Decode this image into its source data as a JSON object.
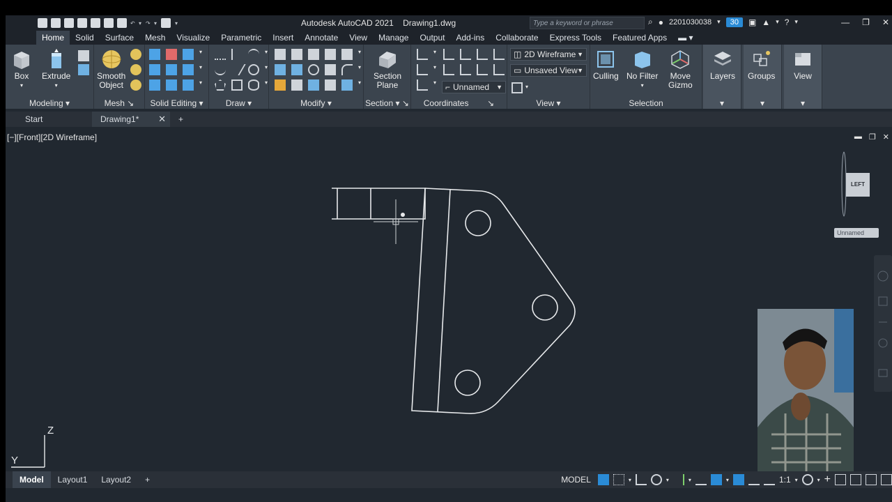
{
  "titlebar": {
    "app_name": "Autodesk AutoCAD 2021",
    "file_name": "Drawing1.dwg",
    "search_placeholder": "Type a keyword or phrase",
    "user_id": "2201030038",
    "notifications": "30"
  },
  "tabs": [
    "Home",
    "Solid",
    "Surface",
    "Mesh",
    "Visualize",
    "Parametric",
    "Insert",
    "Annotate",
    "View",
    "Manage",
    "Output",
    "Add-ins",
    "Collaborate",
    "Express Tools",
    "Featured Apps"
  ],
  "active_tab": "Home",
  "ribbon": {
    "box_label": "Box",
    "extrude_label": "Extrude",
    "smooth_label1": "Smooth",
    "smooth_label2": "Object",
    "section_label1": "Section",
    "section_label2": "Plane",
    "culling_label": "Culling",
    "nofilter_label": "No Filter",
    "gizmo_label1": "Move",
    "gizmo_label2": "Gizmo",
    "layers_label": "Layers",
    "groups_label": "Groups",
    "view_label": "View",
    "visual_style": "2D Wireframe",
    "saved_view": "Unsaved View",
    "ucs_name": "Unnamed",
    "panels": {
      "modeling": "Modeling",
      "mesh": "Mesh",
      "solid_editing": "Solid Editing",
      "draw": "Draw",
      "modify": "Modify",
      "section": "Section",
      "coordinates": "Coordinates",
      "view": "View",
      "selection": "Selection"
    }
  },
  "doc_tabs": {
    "start": "Start",
    "drawing": "Drawing1*"
  },
  "viewport": {
    "label": "[−][Front][2D Wireframe]",
    "viewcube_face": "LEFT",
    "viewcube_ucs": "Unnamed",
    "ucs_axis_z": "Z",
    "ucs_axis_y": "Y"
  },
  "statusbar": {
    "layouts": [
      "Model",
      "Layout1",
      "Layout2"
    ],
    "model_label": "MODEL",
    "scale": "1:1"
  },
  "colors": {
    "accent": "#2a8bd6",
    "canvas": "#212830",
    "ribbon": "#3b444e"
  }
}
